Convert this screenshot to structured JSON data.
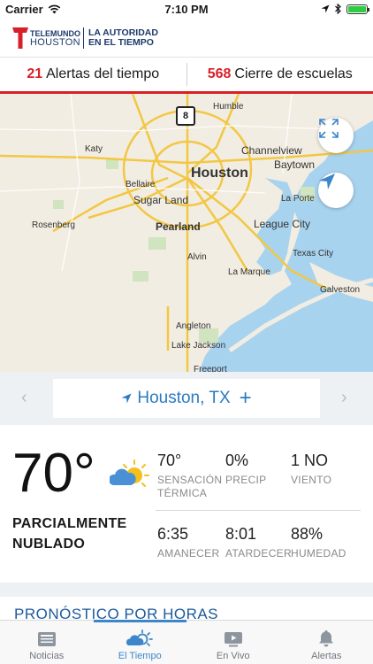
{
  "status_bar": {
    "carrier": "Carrier",
    "time": "7:10 PM",
    "battery_level": 1.0
  },
  "brand": {
    "line1": "TELEMUNDO",
    "line2": "HOUSTON",
    "tagline1": "LA AUTORIDAD",
    "tagline2": "EN EL TIEMPO",
    "logo_color": "#d8202a",
    "text_color": "#1c3a6b"
  },
  "alerts": {
    "weather_count": "21",
    "weather_label": "Alertas del tiempo",
    "schools_count": "568",
    "schools_label": "Cierre de escuelas",
    "accent": "#d8202a"
  },
  "map": {
    "labels": {
      "humble": "Humble",
      "highway": "8",
      "katy": "Katy",
      "channelview": "Channelview",
      "baytown": "Baytown",
      "houston": "Houston",
      "bellaire": "Bellaire",
      "sugar_land": "Sugar Land",
      "la_porte": "La Porte",
      "rosenberg": "Rosenberg",
      "pearland": "Pearland",
      "league_city": "League City",
      "texas_city": "Texas City",
      "alvin": "Alvin",
      "la_marque": "La Marque",
      "galveston": "Galveston",
      "angleton": "Angleton",
      "lake_jackson": "Lake Jackson",
      "freeport": "Freeport"
    },
    "expand_icon": "expand-icon",
    "locate_icon": "location-arrow-icon"
  },
  "location": {
    "name": "Houston, TX",
    "add_symbol": "+",
    "prev_symbol": "‹",
    "next_symbol": "›"
  },
  "current": {
    "temperature": "70°",
    "condition_line1": "PARCIALMENTE",
    "condition_line2": "NUBLADO",
    "condition_icon": "partly-cloudy-icon",
    "feels_like_value": "70°",
    "feels_like_label1": "SENSACIÓN",
    "feels_like_label2": "TÉRMICA",
    "precip_value": "0%",
    "precip_label": "PRECIP",
    "wind_value": "1 NO",
    "wind_label": "VIENTO",
    "sunrise_value": "6:35",
    "sunrise_label": "AMANECER",
    "sunset_value": "8:01",
    "sunset_label": "ATARDECER",
    "humidity_value": "88%",
    "humidity_label": "HUMEDAD"
  },
  "hourly": {
    "title": "PRONÓSTICO POR HORAS"
  },
  "tabs": [
    {
      "label": "Noticias",
      "icon": "news-icon",
      "active": false
    },
    {
      "label": "El Tiempo",
      "icon": "weather-icon",
      "active": true
    },
    {
      "label": "En Vivo",
      "icon": "live-video-icon",
      "active": false
    },
    {
      "label": "Alertas",
      "icon": "bell-icon",
      "active": false
    }
  ]
}
